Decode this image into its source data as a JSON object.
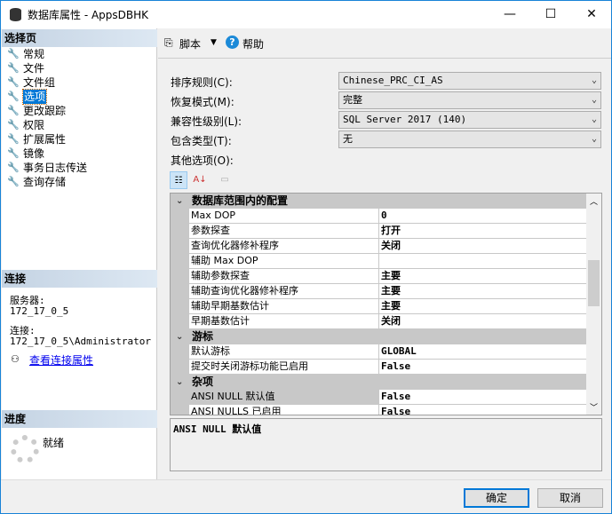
{
  "window": {
    "title": "数据库属性 - AppsDBHK",
    "minimize": "—",
    "maximize": "☐",
    "close": "✕"
  },
  "left": {
    "select_page_header": "选择页",
    "pages": [
      {
        "label": "常规"
      },
      {
        "label": "文件"
      },
      {
        "label": "文件组"
      },
      {
        "label": "选项",
        "selected": true
      },
      {
        "label": "更改跟踪"
      },
      {
        "label": "权限"
      },
      {
        "label": "扩展属性"
      },
      {
        "label": "镜像"
      },
      {
        "label": "事务日志传送"
      },
      {
        "label": "查询存储"
      }
    ],
    "connection_header": "连接",
    "server_label": "服务器:",
    "server_value": "172_17_0_5",
    "connection_label": "连接:",
    "connection_value": "172_17_0_5\\Administrator",
    "view_connection_link": "查看连接属性",
    "progress_header": "进度",
    "progress_status": "就绪"
  },
  "toolbar": {
    "script_label": "脚本",
    "help_label": "帮助"
  },
  "form": {
    "collation_label": "排序规则(C):",
    "collation_value": "Chinese_PRC_CI_AS",
    "recovery_label": "恢复模式(M):",
    "recovery_value": "完整",
    "compat_label": "兼容性级别(L):",
    "compat_value": "SQL Server 2017 (140)",
    "containment_label": "包含类型(T):",
    "containment_value": "无",
    "other_label": "其他选项(O):"
  },
  "grid": {
    "categories": [
      {
        "title": "数据库范围内的配置",
        "rows": [
          {
            "name": "Max DOP",
            "value": "0"
          },
          {
            "name": "参数探查",
            "value": "打开"
          },
          {
            "name": "查询优化器修补程序",
            "value": "关闭"
          },
          {
            "name": "辅助 Max DOP",
            "value": ""
          },
          {
            "name": "辅助参数探查",
            "value": "主要"
          },
          {
            "name": "辅助查询优化器修补程序",
            "value": "主要"
          },
          {
            "name": "辅助早期基数估计",
            "value": "主要"
          },
          {
            "name": "早期基数估计",
            "value": "关闭"
          }
        ]
      },
      {
        "title": "游标",
        "rows": [
          {
            "name": "默认游标",
            "value": "GLOBAL"
          },
          {
            "name": "提交时关闭游标功能已启用",
            "value": "False"
          }
        ]
      },
      {
        "title": "杂项",
        "rows": [
          {
            "name": "ANSI NULL 默认值",
            "value": "False",
            "selected": true
          },
          {
            "name": "ANSI NULLS 已启用",
            "value": "False"
          }
        ]
      }
    ],
    "description": "ANSI NULL 默认值"
  },
  "buttons": {
    "ok": "确定",
    "cancel": "取消"
  }
}
